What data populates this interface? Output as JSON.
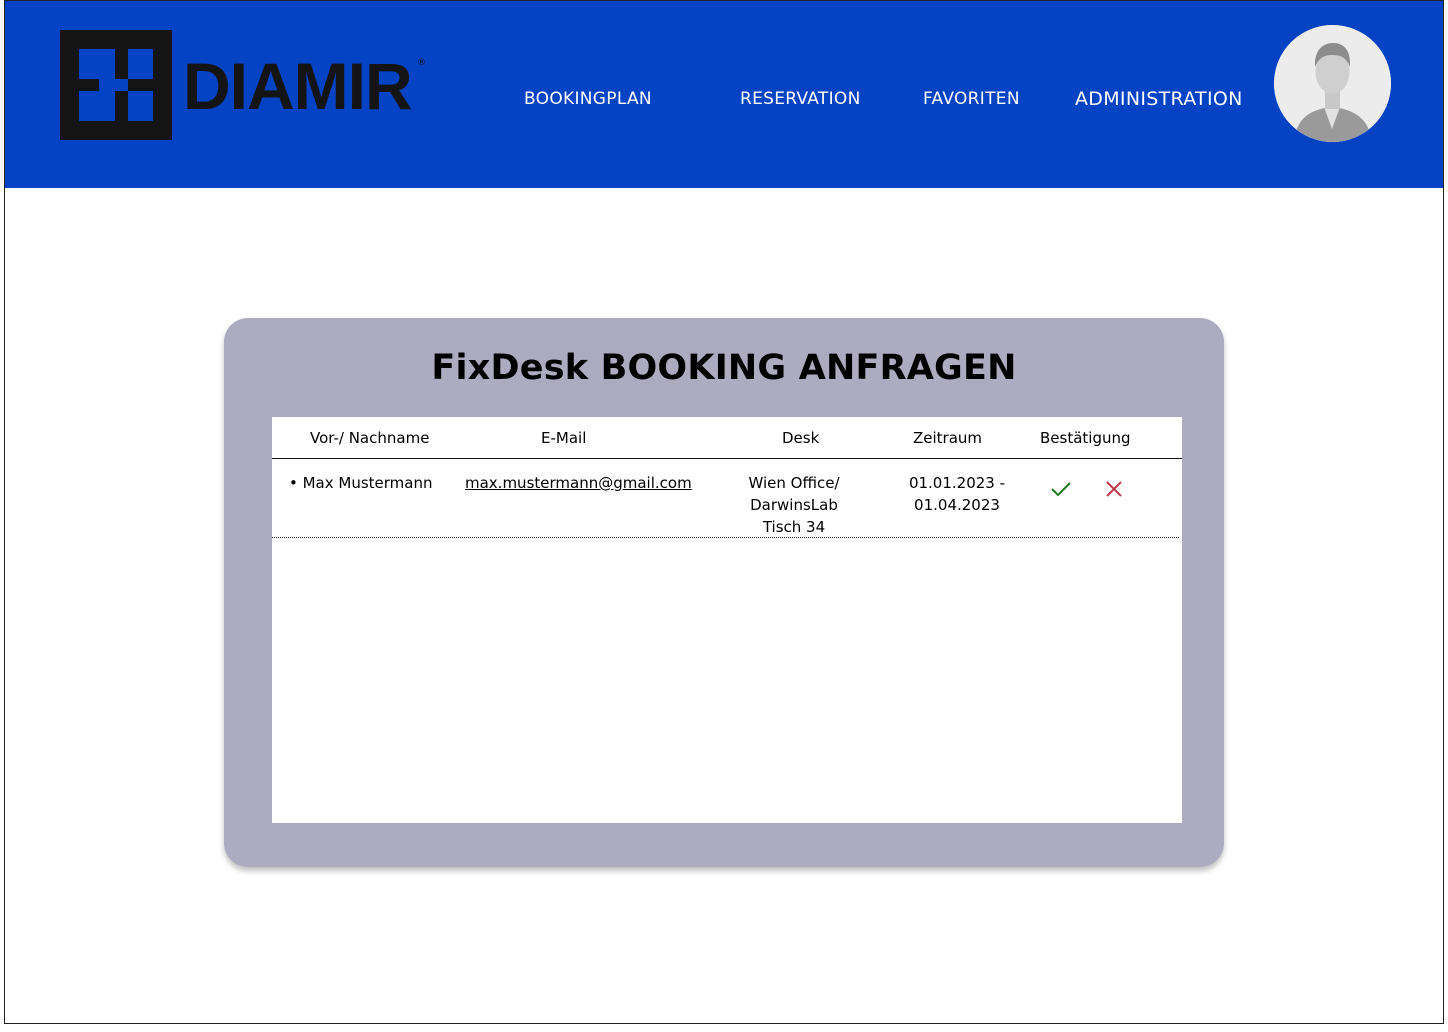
{
  "brand": {
    "name": "DIAMIR",
    "registered": "®"
  },
  "nav": {
    "bookingplan": "BOOKINGPLAN",
    "reservation": "RESERVATION",
    "favoriten": "FAVORITEN",
    "administration": "ADMINISTRATION"
  },
  "colors": {
    "header_bg": "#0443c3",
    "panel_bg": "#adabbf",
    "accept": "#1f7a1f",
    "reject": "#c0384b"
  },
  "panel": {
    "title": "FixDesk BOOKING ANFRAGEN"
  },
  "table": {
    "columns": [
      "Vor-/ Nachname",
      "E-Mail",
      "Desk",
      "Zeitraum",
      "Bestätigung"
    ],
    "rows": [
      {
        "name": "• Max Mustermann",
        "email": "max.mustermann@gmail.com",
        "desk_line1": "Wien Office/",
        "desk_line2": "DarwinsLab",
        "desk_line3": "Tisch 34",
        "zeitraum_line1": "01.01.2023 -",
        "zeitraum_line2": "01.04.2023",
        "accept_icon": "checkmark-icon",
        "reject_icon": "close-x-icon"
      }
    ]
  },
  "icons": {
    "avatar": "user-avatar-icon",
    "logo": "diamir-logo-icon"
  }
}
